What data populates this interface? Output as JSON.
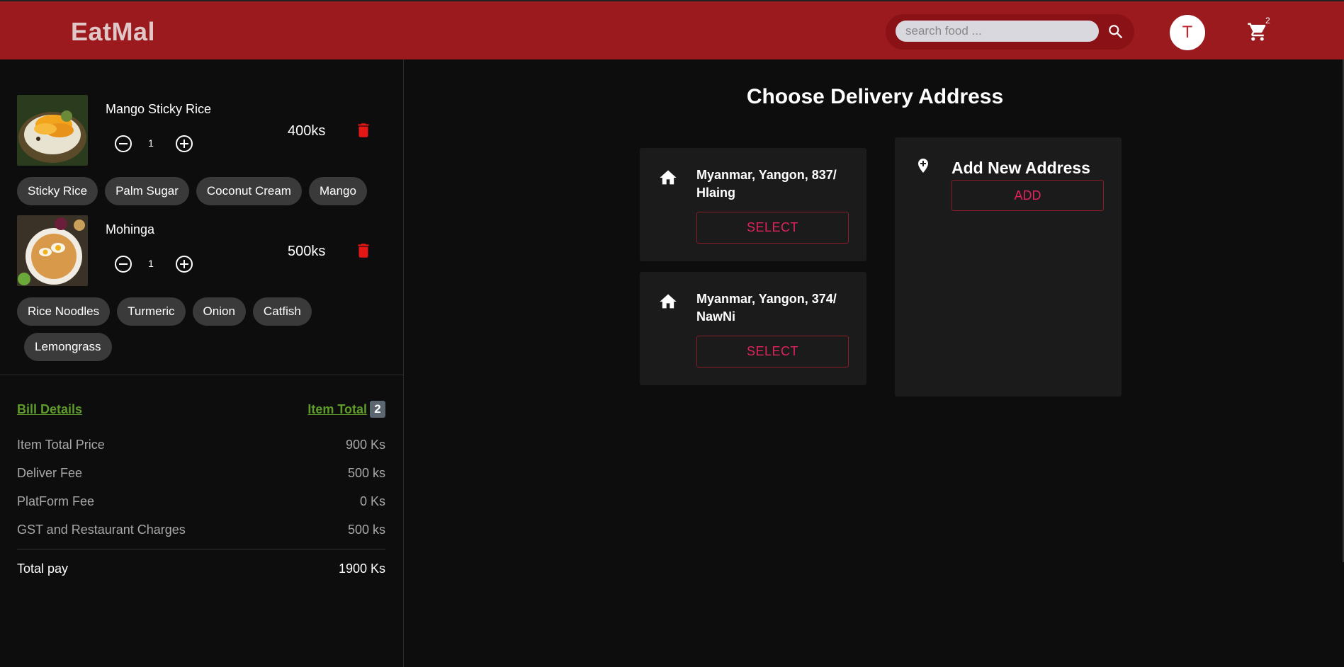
{
  "header": {
    "brand": "EatMal",
    "search_placeholder": "search food ...",
    "search_icon": "search-icon",
    "avatar_initial": "T",
    "cart_icon": "cart-icon",
    "cart_count": "2",
    "bg_color": "#9b1a1e"
  },
  "cart": {
    "items": [
      {
        "name": "Mango Sticky Rice",
        "qty": "1",
        "price": "400ks",
        "ingredients": [
          "Sticky Rice",
          "Palm Sugar",
          "Coconut Cream",
          "Mango"
        ]
      },
      {
        "name": "Mohinga",
        "qty": "1",
        "price": "500ks",
        "ingredients": [
          "Rice Noodles",
          "Turmeric",
          "Onion",
          "Catfish",
          "Lemongrass"
        ]
      }
    ]
  },
  "bill": {
    "title": "Bill Details",
    "item_total_label": "Item Total",
    "item_total_count": "2",
    "rows": [
      {
        "label": "Item Total Price",
        "value": "900 Ks"
      },
      {
        "label": "Deliver Fee",
        "value": "500 ks"
      },
      {
        "label": "PlatForm Fee",
        "value": "0 Ks"
      },
      {
        "label": "GST and Restaurant Charges",
        "value": "500 ks"
      }
    ],
    "total_label": "Total pay",
    "total_value": "1900 Ks"
  },
  "delivery": {
    "title": "Choose Delivery Address",
    "addresses": [
      {
        "text": "Myanmar, Yangon, 837/ Hlaing",
        "button": "SELECT"
      },
      {
        "text": "Myanmar, Yangon, 374/ NawNi",
        "button": "SELECT"
      }
    ],
    "new_address": {
      "title": "Add New Address",
      "button": "ADD"
    },
    "accent_color": "#e0245e"
  }
}
